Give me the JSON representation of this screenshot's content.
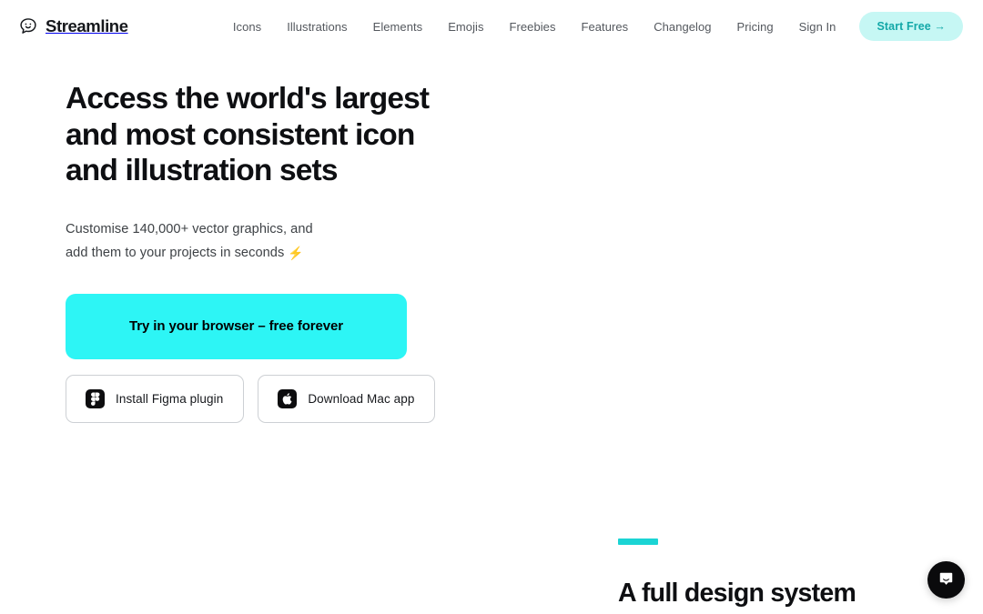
{
  "brand": {
    "name": "Streamline",
    "logo_icon": "speech-bubble-smiley-icon"
  },
  "nav": {
    "links": [
      {
        "label": "Icons"
      },
      {
        "label": "Illustrations"
      },
      {
        "label": "Elements"
      },
      {
        "label": "Emojis"
      },
      {
        "label": "Freebies"
      },
      {
        "label": "Features"
      },
      {
        "label": "Changelog"
      },
      {
        "label": "Pricing"
      },
      {
        "label": "Sign In"
      }
    ],
    "cta": {
      "label": "Start Free →",
      "bg_color": "#C6F7F4",
      "text_color": "#13A8A8"
    }
  },
  "hero": {
    "title": "Access the world's largest and most consistent icon and illustration sets",
    "subtitle_line1": "Customise 140,000+ vector graphics, and",
    "subtitle_line2": "add them to your projects in seconds",
    "subtitle_emoji": "⚡",
    "primary_cta": {
      "label": "Try in your browser – free forever",
      "bg_color": "#2DF5F5",
      "text_color": "#000000"
    },
    "secondary_buttons": [
      {
        "label": "Install Figma plugin",
        "icon": "figma-icon"
      },
      {
        "label": "Download Mac app",
        "icon": "apple-icon"
      }
    ]
  },
  "lower_section": {
    "eyebrow_color": "#1BD4D4",
    "title": "A full design system"
  },
  "chat": {
    "icon": "chat-message-icon",
    "bg_color": "#0A0A0C"
  }
}
